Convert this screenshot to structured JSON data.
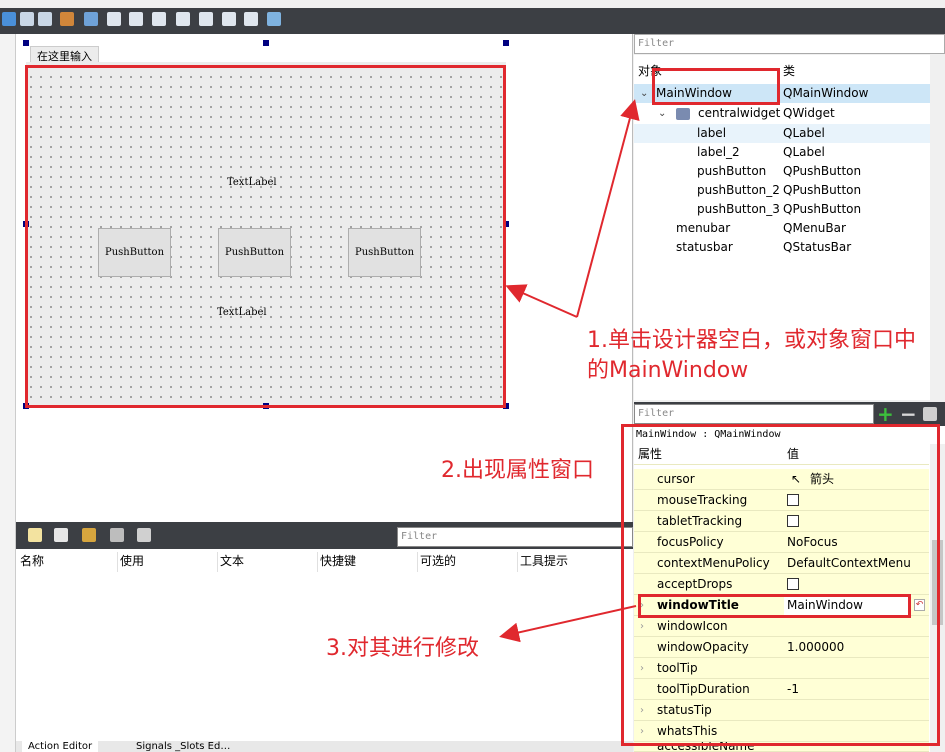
{
  "designer": {
    "menu_entry": "在这里输入",
    "widgets": {
      "text_label_1": "TextLabel",
      "text_label_2": "TextLabel",
      "push_buttons": [
        "PushButton",
        "PushButton",
        "PushButton"
      ]
    }
  },
  "action_editor": {
    "filter_placeholder": "Filter",
    "columns": [
      "名称",
      "使用",
      "文本",
      "快捷键",
      "可选的",
      "工具提示"
    ],
    "tabs": [
      "Action Editor",
      "Signals _Slots Ed…"
    ]
  },
  "object_inspector": {
    "filter_placeholder": "Filter",
    "headers": {
      "object": "对象",
      "class": "类"
    },
    "rows": [
      {
        "name": "MainWindow",
        "class": "QMainWindow"
      },
      {
        "name": "centralwidget",
        "class": "QWidget"
      },
      {
        "name": "label",
        "class": "QLabel"
      },
      {
        "name": "label_2",
        "class": "QLabel"
      },
      {
        "name": "pushButton",
        "class": "QPushButton"
      },
      {
        "name": "pushButton_2",
        "class": "QPushButton"
      },
      {
        "name": "pushButton_3",
        "class": "QPushButton"
      },
      {
        "name": "menubar",
        "class": "QMenuBar"
      },
      {
        "name": "statusbar",
        "class": "QStatusBar"
      }
    ]
  },
  "property_editor": {
    "filter_placeholder": "Filter",
    "title": "MainWindow : QMainWindow",
    "headers": {
      "property": "属性",
      "value": "值"
    },
    "rows": [
      {
        "name": "cursor",
        "value": "箭头"
      },
      {
        "name": "mouseTracking",
        "value": ""
      },
      {
        "name": "tabletTracking",
        "value": ""
      },
      {
        "name": "focusPolicy",
        "value": "NoFocus"
      },
      {
        "name": "contextMenuPolicy",
        "value": "DefaultContextMenu"
      },
      {
        "name": "acceptDrops",
        "value": ""
      },
      {
        "name": "windowTitle",
        "value": "MainWindow"
      },
      {
        "name": "windowIcon",
        "value": ""
      },
      {
        "name": "windowOpacity",
        "value": "1.000000"
      },
      {
        "name": "toolTip",
        "value": ""
      },
      {
        "name": "toolTipDuration",
        "value": "-1"
      },
      {
        "name": "statusTip",
        "value": ""
      },
      {
        "name": "whatsThis",
        "value": ""
      },
      {
        "name": "accessibleName",
        "value": ""
      }
    ]
  },
  "annotations": {
    "step1_line1": "1.单击设计器空白，或对象窗口中",
    "step1_line2": "的MainWindow",
    "step2": "2.出现属性窗口",
    "step3": "3.对其进行修改"
  }
}
